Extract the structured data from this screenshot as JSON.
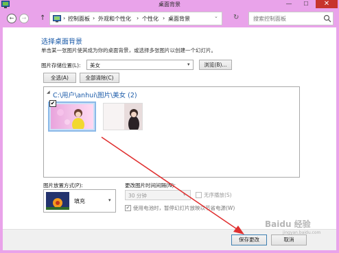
{
  "window": {
    "title": "桌面背景",
    "minimize_glyph": "—",
    "maximize_glyph": "☐",
    "close_glyph": "✕"
  },
  "nav": {
    "back_glyph": "←",
    "forward_glyph": "→",
    "up_glyph": "↑",
    "breadcrumbs": [
      "控制面板",
      "外观和个性化",
      "个性化",
      "桌面背景"
    ],
    "separator": "›",
    "dropdown_glyph": "⌄",
    "refresh_glyph": "↻",
    "search_placeholder": "搜索控制面板"
  },
  "main": {
    "heading": "选择桌面背景",
    "description": "单击某一张图片使其成为你的桌面背景，或选择多张图片以创建一个幻灯片。",
    "location_label": "图片存储位置(L):",
    "location_value": "美女",
    "browse_label": "浏览(B)...",
    "select_all_label": "全选(A)",
    "clear_all_label": "全部清除(C)",
    "group_header": "C:\\用户\\anhui\\图片\\美女 (2)",
    "group_caret": "◢",
    "thumb1_checked": true,
    "check_glyph": "✔"
  },
  "options": {
    "position_label": "图片放置方式(P):",
    "position_value": "填充",
    "interval_label": "更改图片时间间隔(N):",
    "interval_value": "30 分钟",
    "shuffle_label": "无序播放(S)",
    "shuffle_checked": false,
    "battery_label": "使用电池时，暂停幻灯片放映以节省电源(W)",
    "battery_checked": true,
    "select_arrow": "▾"
  },
  "footer": {
    "save_label": "保存更改",
    "cancel_label": "取消"
  },
  "watermark": {
    "text": "Baidu 经验",
    "sub": "jingyan.baidu.com"
  },
  "colors": {
    "window_frame": "#e9a3ea",
    "heading_blue": "#1a5aa8",
    "close_red": "#c7342c",
    "annotation_red": "#e03030"
  }
}
